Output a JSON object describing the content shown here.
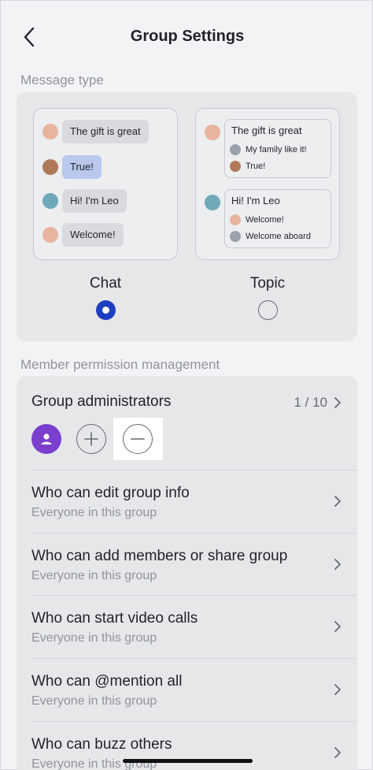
{
  "header": {
    "title": "Group Settings"
  },
  "message_type": {
    "section_label": "Message type",
    "chat_preview": {
      "bubbles": [
        "The gift is great",
        "True!",
        "Hi! I'm Leo",
        "Welcome!"
      ]
    },
    "topic_preview": {
      "topics": [
        {
          "title": "The gift is great",
          "replies": [
            "My family like it!",
            "True!"
          ]
        },
        {
          "title": "Hi! I'm Leo",
          "replies": [
            "Welcome!",
            "Welcome aboard"
          ]
        }
      ]
    },
    "options": [
      {
        "label": "Chat",
        "selected": true
      },
      {
        "label": "Topic",
        "selected": false
      }
    ],
    "accent_color": "#1d3fbf"
  },
  "permissions": {
    "section_label": "Member permission management",
    "admins": {
      "title": "Group administrators",
      "count": "1 / 10"
    },
    "rows": [
      {
        "title": "Who can edit group info",
        "value": "Everyone in this group"
      },
      {
        "title": "Who can add members or share group",
        "value": "Everyone in this group"
      },
      {
        "title": "Who can start video calls",
        "value": "Everyone in this group"
      },
      {
        "title": "Who can @mention all",
        "value": "Everyone in this group"
      },
      {
        "title": "Who can buzz others",
        "value": "Everyone in this group"
      }
    ]
  },
  "icons": {
    "back": "chevron-left-icon",
    "chevron": "chevron-right-icon",
    "add": "plus-circle-icon",
    "remove": "minus-circle-icon",
    "admin": "person-icon"
  }
}
